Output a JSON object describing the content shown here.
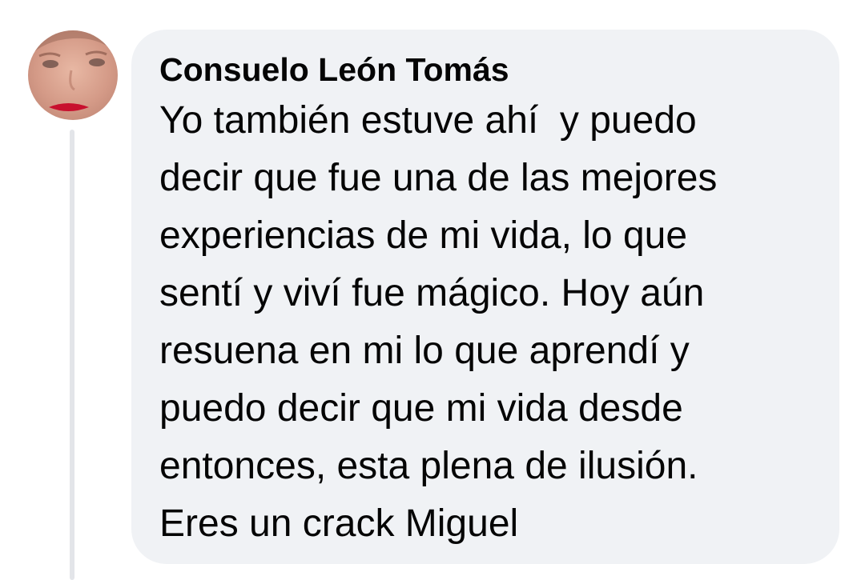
{
  "comment": {
    "author": "Consuelo León Tomás",
    "text_lines": [
      "Yo también estuve ahí  y puedo",
      "decir que fue una de las mejores",
      "experiencias de mi vida, lo que",
      "sentí y viví fue mágico. Hoy aún",
      "resuena en mi lo que aprendí y",
      "puedo decir que mi vida desde",
      "entonces, esta plena de ilusión.",
      "Eres un crack Miguel"
    ]
  },
  "colors": {
    "bubble_background": "#f0f2f5",
    "text": "#050505",
    "thread_line": "#e3e5e9"
  }
}
